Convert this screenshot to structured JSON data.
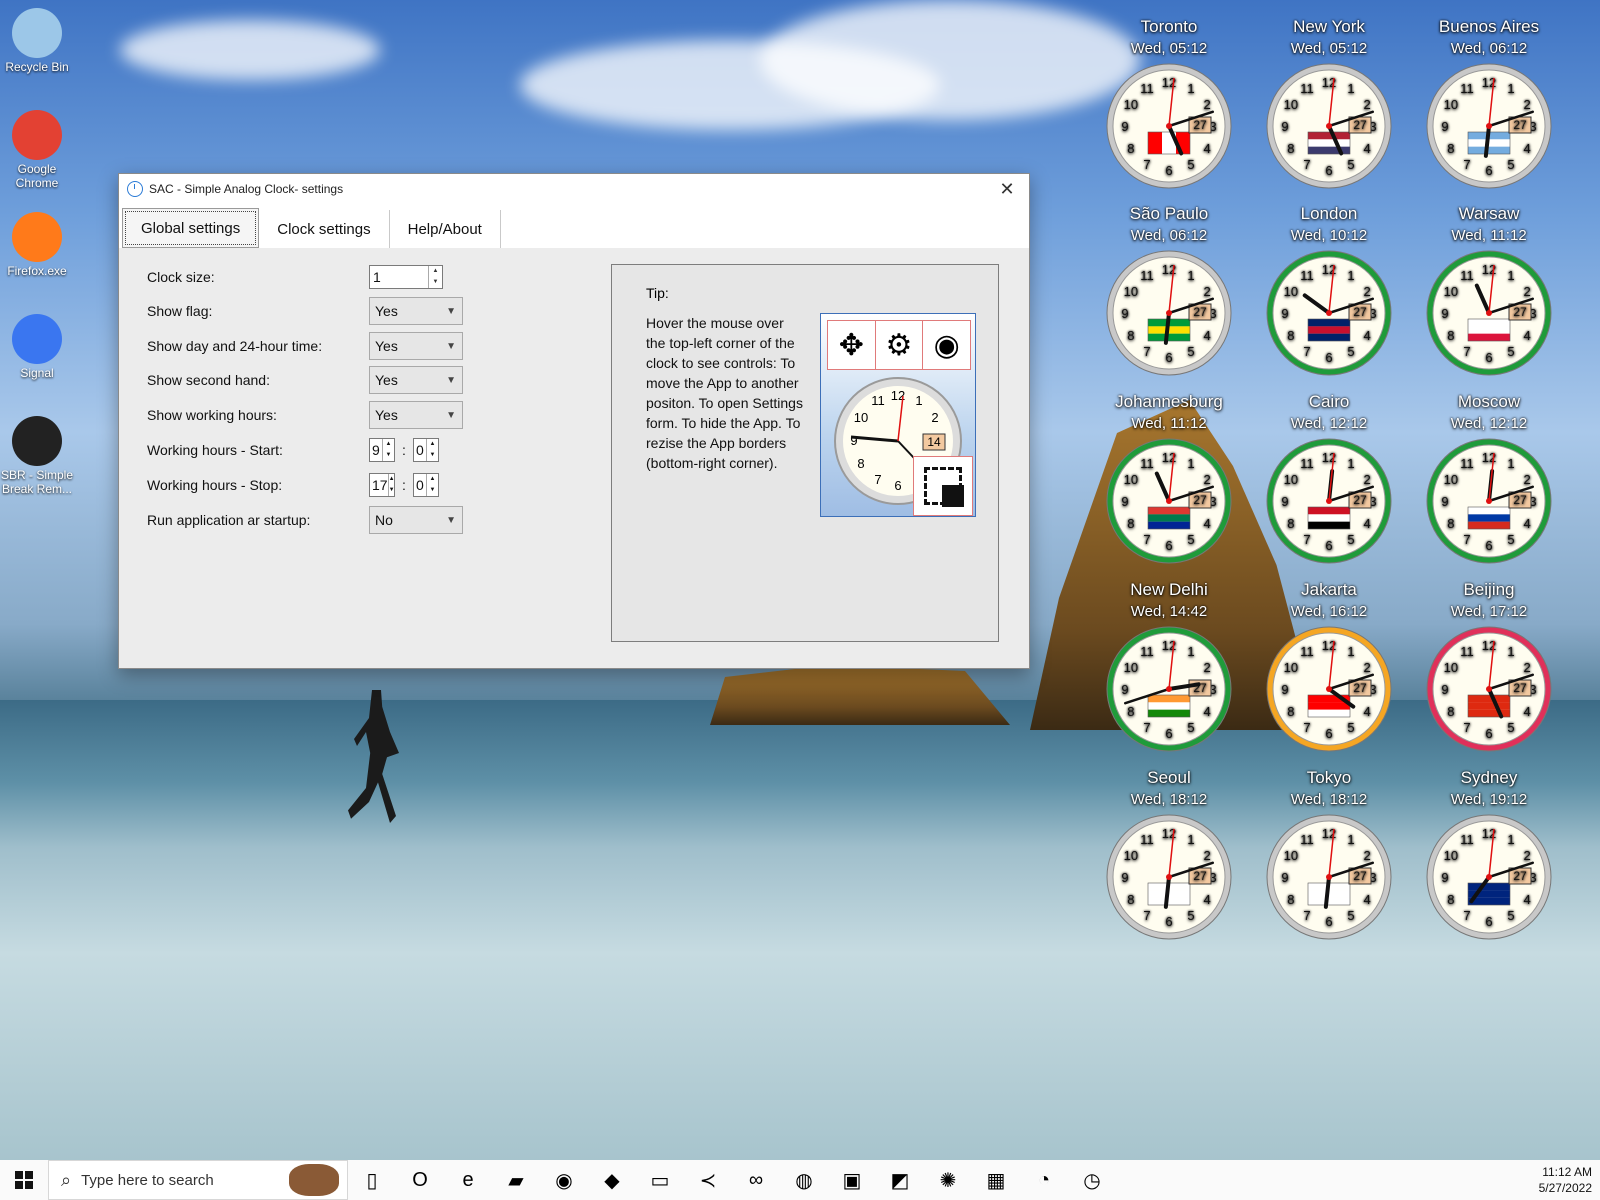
{
  "desktop": {
    "icons": [
      {
        "label": "Recycle Bin",
        "name": "recycle-bin-icon",
        "color": "#9cc7e8"
      },
      {
        "label": "Google Chrome",
        "name": "chrome-icon",
        "color": "#e34133"
      },
      {
        "label": "Firefox.exe",
        "name": "firefox-icon",
        "color": "#ff7a1a"
      },
      {
        "label": "Signal",
        "name": "signal-icon",
        "color": "#3a76f0"
      },
      {
        "label": "SBR - Simple Break Rem...",
        "name": "sbr-icon",
        "color": "#222222"
      }
    ]
  },
  "window": {
    "title": "SAC - Simple Analog Clock- settings",
    "close_glyph": "✕",
    "tabs": [
      {
        "label": "Global settings",
        "active": true
      },
      {
        "label": "Clock settings",
        "active": false
      },
      {
        "label": "Help/About",
        "active": false
      }
    ],
    "settings": {
      "clock_size": {
        "label": "Clock size:",
        "value": "1"
      },
      "show_flag": {
        "label": "Show flag:",
        "value": "Yes"
      },
      "show_day": {
        "label": "Show day and 24-hour time:",
        "value": "Yes"
      },
      "show_second": {
        "label": "Show second hand:",
        "value": "Yes"
      },
      "show_working": {
        "label": "Show working hours:",
        "value": "Yes"
      },
      "work_start": {
        "label": "Working hours - Start:",
        "hour": "9",
        "minute": "0"
      },
      "work_stop": {
        "label": "Working hours - Stop:",
        "hour": "17",
        "minute": "0"
      },
      "run_startup": {
        "label": "Run application ar startup:",
        "value": "No"
      },
      "colon": ":"
    },
    "tip": {
      "title": "Tip:",
      "text": "Hover the mouse over the top-left corner of the clock to see controls: To move the App to another positon. To open Settings form. To hide the App. To rezise the App borders (bottom-right corner).",
      "image_date": "14",
      "image_numbers": [
        "12",
        "11",
        "1",
        "10",
        "2",
        "9",
        "8",
        "7",
        "6"
      ]
    }
  },
  "clocks": [
    {
      "city": "Toronto",
      "time": "Wed, 05:12",
      "hour": 5,
      "minute": 12,
      "ring": "#c8c8c8",
      "flag": [
        "#ff0000",
        "#ffffff",
        "#ff0000"
      ],
      "flag_dir": "v"
    },
    {
      "city": "New York",
      "time": "Wed, 05:12",
      "hour": 5,
      "minute": 12,
      "ring": "#c8c8c8",
      "flag": [
        "#b22234",
        "#ffffff",
        "#3c3b6e"
      ],
      "flag_dir": "h"
    },
    {
      "city": "Buenos Aires",
      "time": "Wed, 06:12",
      "hour": 6,
      "minute": 12,
      "ring": "#c8c8c8",
      "flag": [
        "#74acdf",
        "#ffffff",
        "#74acdf"
      ],
      "flag_dir": "h"
    },
    {
      "city": "São Paulo",
      "time": "Wed, 06:12",
      "hour": 6,
      "minute": 12,
      "ring": "#c8c8c8",
      "flag": [
        "#009b3a",
        "#fedf00",
        "#009b3a"
      ],
      "flag_dir": "h"
    },
    {
      "city": "London",
      "time": "Wed, 10:12",
      "hour": 10,
      "minute": 12,
      "ring": "#1f9b3a",
      "flag": [
        "#012169",
        "#c8102e",
        "#012169"
      ],
      "flag_dir": "h"
    },
    {
      "city": "Warsaw",
      "time": "Wed, 11:12",
      "hour": 11,
      "minute": 12,
      "ring": "#1f9b3a",
      "flag": [
        "#ffffff",
        "#ffffff",
        "#dc143c"
      ],
      "flag_dir": "h"
    },
    {
      "city": "Johannesburg",
      "time": "Wed, 11:12",
      "hour": 11,
      "minute": 12,
      "ring": "#1f9b3a",
      "flag": [
        "#de3831",
        "#007a4d",
        "#002395"
      ],
      "flag_dir": "h"
    },
    {
      "city": "Cairo",
      "time": "Wed, 12:12",
      "hour": 12,
      "minute": 12,
      "ring": "#1f9b3a",
      "flag": [
        "#ce1126",
        "#ffffff",
        "#000000"
      ],
      "flag_dir": "h"
    },
    {
      "city": "Moscow",
      "time": "Wed, 12:12",
      "hour": 12,
      "minute": 12,
      "ring": "#1f9b3a",
      "flag": [
        "#ffffff",
        "#0039a6",
        "#d52b1e"
      ],
      "flag_dir": "h"
    },
    {
      "city": "New Delhi",
      "time": "Wed, 14:42",
      "hour": 14,
      "minute": 42,
      "ring": "#1f9b3a",
      "flag": [
        "#ff9933",
        "#ffffff",
        "#138808"
      ],
      "flag_dir": "h"
    },
    {
      "city": "Jakarta",
      "time": "Wed, 16:12",
      "hour": 16,
      "minute": 12,
      "ring": "#f5a623",
      "flag": [
        "#ff0000",
        "#ff0000",
        "#ffffff"
      ],
      "flag_dir": "h"
    },
    {
      "city": "Beijing",
      "time": "Wed, 17:12",
      "hour": 17,
      "minute": 12,
      "ring": "#e0305a",
      "flag": [
        "#de2910",
        "#de2910",
        "#de2910"
      ],
      "flag_dir": "h"
    },
    {
      "city": "Seoul",
      "time": "Wed, 18:12",
      "hour": 18,
      "minute": 12,
      "ring": "#c8c8c8",
      "flag": [
        "#ffffff",
        "#ffffff",
        "#ffffff"
      ],
      "flag_dir": "h"
    },
    {
      "city": "Tokyo",
      "time": "Wed, 18:12",
      "hour": 18,
      "minute": 12,
      "ring": "#c8c8c8",
      "flag": [
        "#ffffff",
        "#ffffff",
        "#ffffff"
      ],
      "flag_dir": "h"
    },
    {
      "city": "Sydney",
      "time": "Wed, 19:12",
      "hour": 19,
      "minute": 12,
      "ring": "#c8c8c8",
      "flag": [
        "#00247d",
        "#00247d",
        "#00247d"
      ],
      "flag_dir": "h"
    }
  ],
  "clock_face": {
    "date": "27",
    "numbers": [
      "12",
      "1",
      "2",
      "3",
      "4",
      "5",
      "6",
      "7",
      "8",
      "9",
      "10",
      "11"
    ]
  },
  "taskbar": {
    "search_placeholder": "Type here to search",
    "apps": [
      {
        "name": "task-view-icon",
        "glyph": "▯"
      },
      {
        "name": "outlook-icon",
        "glyph": "O"
      },
      {
        "name": "edge-icon",
        "glyph": "e"
      },
      {
        "name": "file-explorer-icon",
        "glyph": "▰"
      },
      {
        "name": "chrome-taskbar-icon",
        "glyph": "◉"
      },
      {
        "name": "gimp-icon",
        "glyph": "◆"
      },
      {
        "name": "notepad-icon",
        "glyph": "▭"
      },
      {
        "name": "vscode-icon",
        "glyph": "≺"
      },
      {
        "name": "visual-studio-icon",
        "glyph": "∞"
      },
      {
        "name": "firefox-taskbar-icon",
        "glyph": "◍"
      },
      {
        "name": "save-icon",
        "glyph": "▣"
      },
      {
        "name": "paint-icon",
        "glyph": "◩"
      },
      {
        "name": "network-icon",
        "glyph": "✺"
      },
      {
        "name": "calculator-icon",
        "glyph": "▦"
      },
      {
        "name": "sbr-taskbar-icon",
        "glyph": "◔"
      },
      {
        "name": "sac-taskbar-icon",
        "glyph": "◷"
      }
    ],
    "clock_time": "11:12 AM",
    "clock_date": "5/27/2022"
  }
}
